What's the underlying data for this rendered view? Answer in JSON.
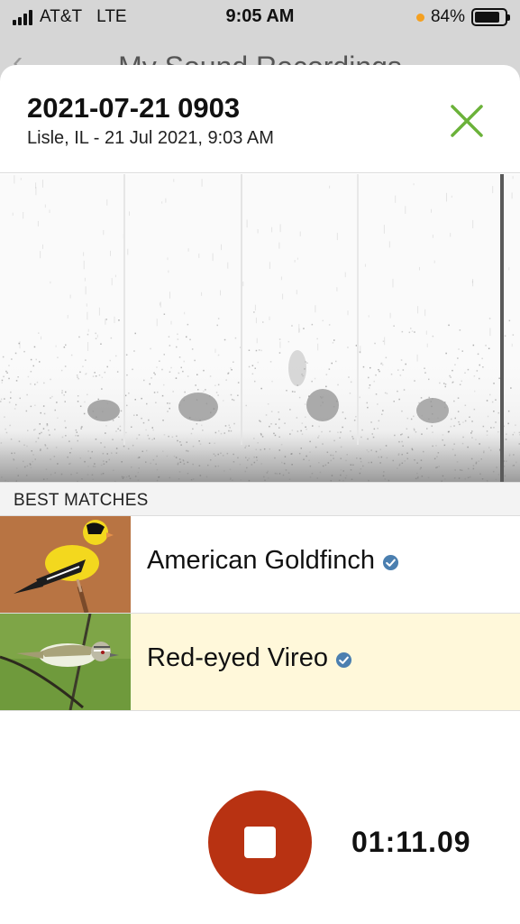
{
  "status_bar": {
    "carrier": "AT&T",
    "network": "LTE",
    "time": "9:05 AM",
    "battery_percent": "84%",
    "battery_level": 0.84
  },
  "background_screen": {
    "title": "My Sound Recordings"
  },
  "recording": {
    "title": "2021-07-21 0903",
    "subtitle": "Lisle, IL - 21 Jul 2021, 9:03 AM"
  },
  "matches": {
    "header": "BEST MATCHES",
    "items": [
      {
        "name": "American Goldfinch",
        "icon": "verified-check-icon"
      },
      {
        "name": "Red-eyed Vireo",
        "icon": "verified-check-icon"
      }
    ]
  },
  "recorder": {
    "elapsed": "01:11.09"
  },
  "colors": {
    "accent_green": "#6bb23a",
    "stop_red": "#b83212",
    "verified_blue": "#4b7fb0",
    "highlight_row": "#fff8da"
  }
}
